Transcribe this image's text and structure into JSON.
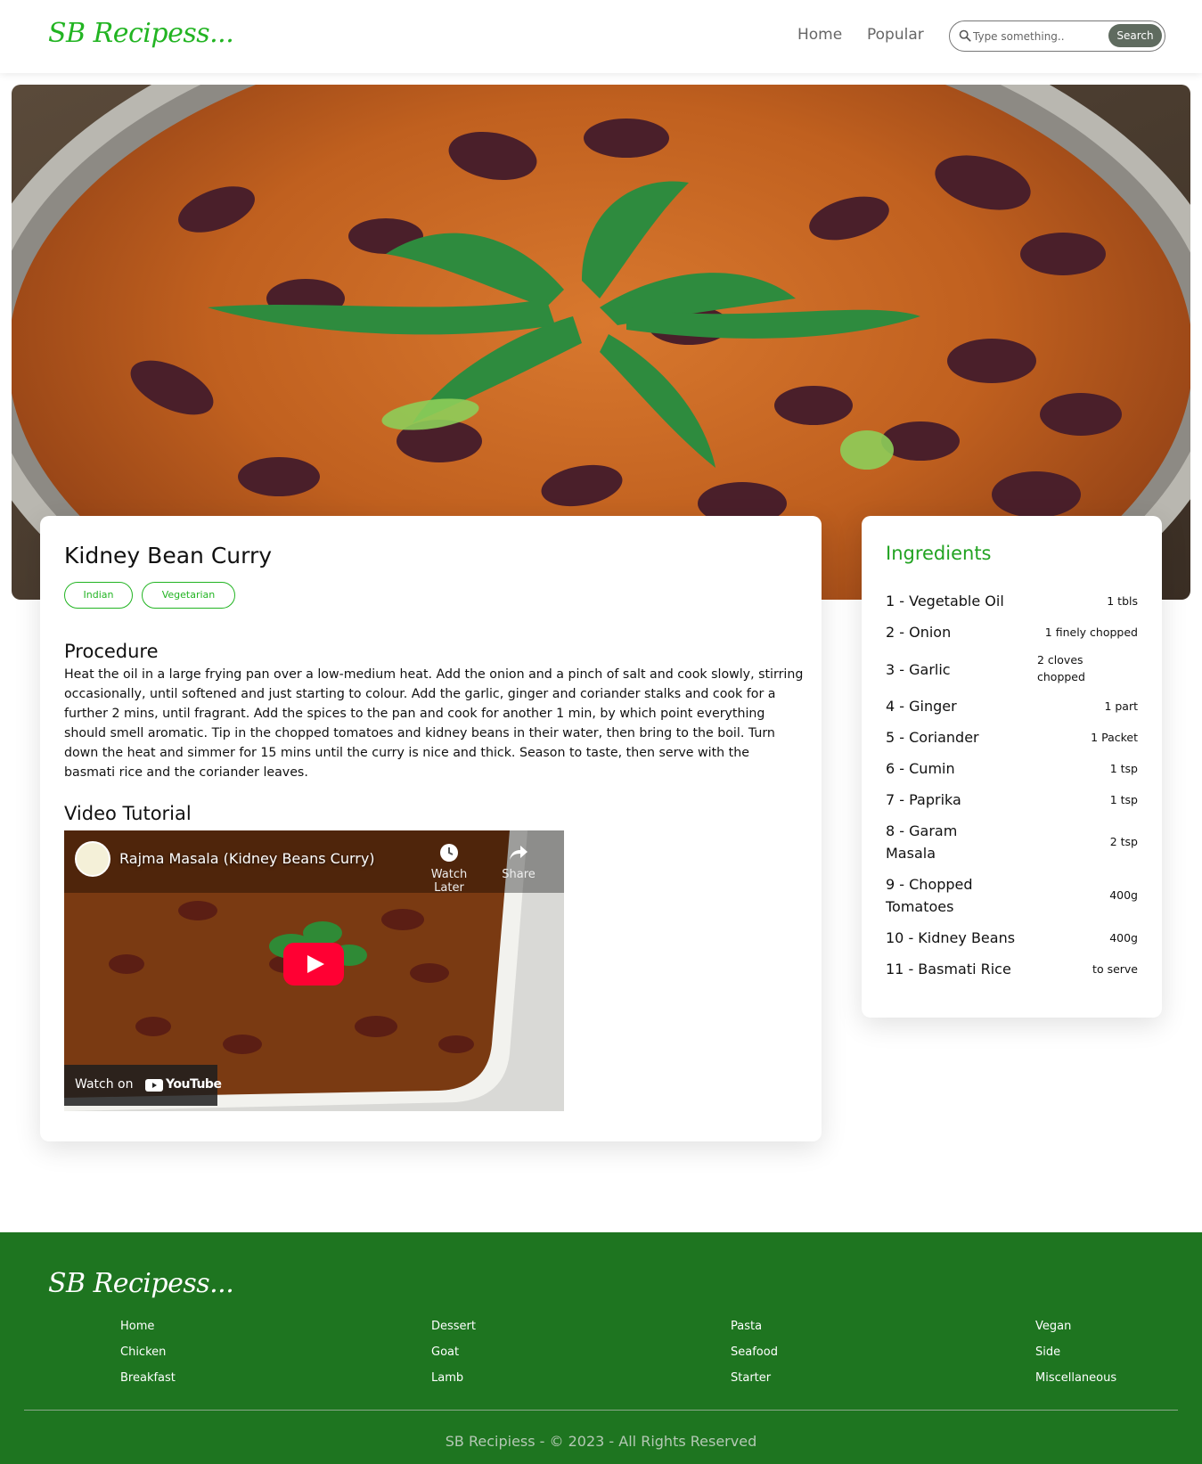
{
  "brand": {
    "logo": "SB Recipess..."
  },
  "nav": {
    "home": "Home",
    "popular": "Popular"
  },
  "search": {
    "placeholder": "Type something..",
    "button": "Search"
  },
  "recipe": {
    "title": "Kidney Bean Curry",
    "tags": [
      "Indian",
      "Vegetarian"
    ],
    "procedure_heading": "Procedure",
    "procedure": "Heat the oil in a large frying pan over a low-medium heat. Add the onion and a pinch of salt and cook slowly, stirring occasionally, until softened and just starting to colour. Add the garlic, ginger and coriander stalks and cook for a further 2 mins, until fragrant.  Add the spices to the pan and cook for another 1 min, by which point everything should smell aromatic. Tip in the chopped tomatoes and kidney beans in their water, then bring to the boil.  Turn down the heat and simmer for 15 mins until the curry is nice and thick. Season to taste, then serve with the basmati rice and the coriander leaves.",
    "video_heading": "Video Tutorial",
    "video": {
      "title": "Rajma Masala (Kidney Beans Curry)",
      "watch_later": "Watch Later",
      "share": "Share",
      "watch_on": "Watch on",
      "platform": "YouTube"
    }
  },
  "ingredients": {
    "title": "Ingredients",
    "items": [
      {
        "name": "1 - Vegetable Oil",
        "qty": "1 tbls"
      },
      {
        "name": "2 - Onion",
        "qty": "1 finely chopped"
      },
      {
        "name": "3 - Garlic",
        "qty": "2 cloves chopped"
      },
      {
        "name": "4 - Ginger",
        "qty": "1 part"
      },
      {
        "name": "5 - Coriander",
        "qty": "1 Packet"
      },
      {
        "name": "6 - Cumin",
        "qty": "1 tsp"
      },
      {
        "name": "7 - Paprika",
        "qty": "1 tsp"
      },
      {
        "name": "8 - Garam Masala",
        "qty": "2 tsp"
      },
      {
        "name": "9 - Chopped Tomatoes",
        "qty": "400g"
      },
      {
        "name": "10 - Kidney Beans",
        "qty": "400g"
      },
      {
        "name": "11 - Basmati Rice",
        "qty": "to serve"
      }
    ]
  },
  "footer": {
    "logo": "SB Recipess...",
    "columns": [
      [
        "Home",
        "Chicken",
        "Breakfast"
      ],
      [
        "Dessert",
        "Goat",
        "Lamb"
      ],
      [
        "Pasta",
        "Seafood",
        "Starter"
      ],
      [
        "Vegan",
        "Side",
        "Miscellaneous"
      ]
    ],
    "copyright": "SB Recipiess - © 2023 - All Rights Reserved"
  },
  "colors": {
    "accent_green": "#22b422",
    "footer_green": "#1e7520",
    "search_button": "#5f6b5f",
    "youtube_red": "#ff0033"
  },
  "icons": [
    "search-icon",
    "clock-icon",
    "share-icon",
    "play-icon",
    "youtube-icon",
    "channel-avatar"
  ]
}
